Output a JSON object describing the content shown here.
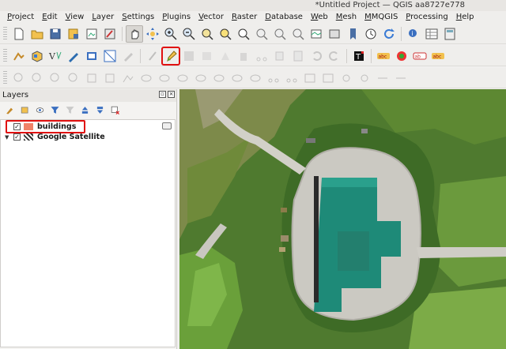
{
  "window": {
    "title": "*Untitled Project — QGIS aa8727e778"
  },
  "menu": [
    "Project",
    "Edit",
    "View",
    "Layer",
    "Settings",
    "Plugins",
    "Vector",
    "Raster",
    "Database",
    "Web",
    "Mesh",
    "MMQGIS",
    "Processing",
    "Help"
  ],
  "toolbar1": [
    "new-project",
    "open-project",
    "save-project",
    "save-as",
    "print-layout",
    "style-manager",
    "pan-map",
    "pan-to-selection",
    "zoom-in",
    "zoom-out",
    "zoom-full",
    "zoom-to-selection",
    "zoom-to-layer",
    "zoom-native",
    "zoom-last",
    "zoom-next",
    "new-bookmark",
    "show-bookmarks",
    "temporal-controller",
    "refresh",
    "identify",
    "attribute-table",
    "field-calculator"
  ],
  "toolbar2": [
    "digitize-tracing",
    "add-vector-layer",
    "add-delimited-text",
    "digitize-brush",
    "add-wms",
    "add-virtual-layer",
    "digitize-brush2",
    "edits",
    "toggle-editing",
    "save-edits",
    "digitize-node",
    "delete-selected",
    "cut-features",
    "copy-features",
    "paste-features",
    "undo",
    "redo",
    "text-annotation",
    "label",
    "pin-labels",
    "label-highlight",
    "rotate-label"
  ],
  "layers_panel": {
    "title": "Layers",
    "items": [
      {
        "name": "buildings",
        "checked": true,
        "color": "#f08268"
      },
      {
        "name": "Google Satellite",
        "checked": true
      }
    ]
  },
  "colors": {
    "highlight": "#e01010",
    "roof": "#1e8a78",
    "grass": "#5f8a36",
    "road": "#c9c7c0"
  }
}
